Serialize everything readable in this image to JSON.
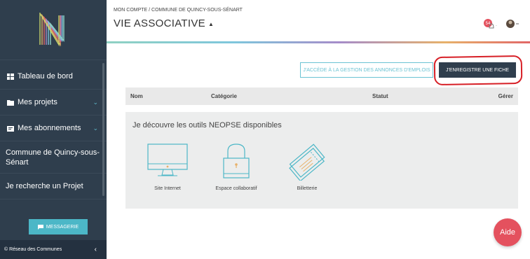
{
  "sidebar": {
    "items": [
      {
        "label": "Tableau de bord",
        "icon": "dashboard-icon"
      },
      {
        "label": "Mes projets",
        "icon": "folder-icon"
      },
      {
        "label": "Mes abonnements",
        "icon": "subscriptions-icon"
      }
    ],
    "commune": "Commune de Quincy-sous-Sénart",
    "search_project": "Je recherche un Projet",
    "messagerie": "MESSAGERIE",
    "footer": "© Réseau des Communes"
  },
  "header": {
    "breadcrumb": "MON COMPTE / COMMUNE DE QUINCY-SOUS-SÉNART",
    "title": "VIE ASSOCIATIVE",
    "notif_count": "54"
  },
  "main": {
    "btn_jobs": "J'ACCÈDE À LA GESTION DES ANNONCES D'EMPLOIS",
    "btn_register": "J'ENREGISTRE UNE FICHE",
    "table_headers": {
      "nom": "Nom",
      "categorie": "Catégorie",
      "statut": "Statut",
      "gerer": "Gérer"
    },
    "tools_title": "Je découvre les outils NEOPSE disponibles",
    "tools": [
      "Site Internet",
      "Espace collaboratif",
      "Billetterie"
    ],
    "aide": "Aide"
  },
  "colors": {
    "sidebar": "#2f3e4d",
    "accent": "#4cb7c7",
    "help": "#e4515e",
    "highlight": "#d71f26"
  }
}
